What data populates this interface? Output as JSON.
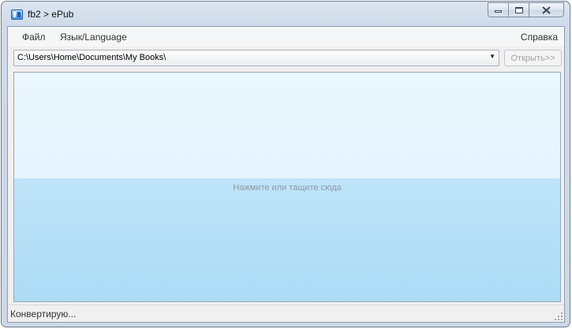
{
  "window": {
    "title": "fb2 > ePub"
  },
  "menu": {
    "file": "Файл",
    "language": "Язык/Language",
    "help": "Справка"
  },
  "path_combo": {
    "value": "C:\\Users\\Home\\Documents\\My Books\\",
    "arrow_glyph": "▼"
  },
  "open_button": {
    "label": "Открыть>>"
  },
  "drop_zone": {
    "hint": "Нажмите или тащите сюда"
  },
  "status": {
    "text": "Конвертирую..."
  },
  "colors": {
    "drop_zone_top": "#eaf7ff",
    "drop_zone_bottom": "#acdbf6",
    "titlebar": "#dbe5f1"
  }
}
